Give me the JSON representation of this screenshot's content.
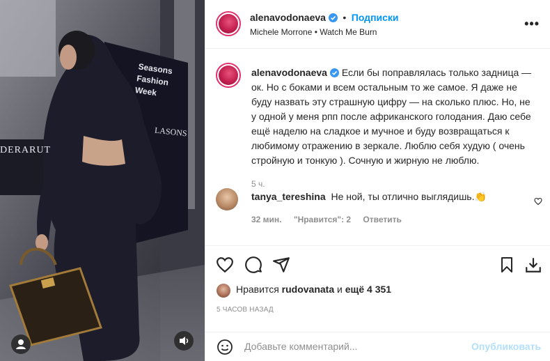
{
  "header": {
    "username": "alenavodonaeva",
    "dot": "•",
    "follow_label": "Подписки",
    "audio": "Michele Morrone • Watch Me Burn",
    "more": "•••"
  },
  "caption": {
    "username": "alenavodonaeva",
    "text": "Если бы поправлялась только задница — ок. Но с боками и всем остальным то же самое. Я даже не буду назвать эту страшную цифру — на сколько плюс. Но, не у одной у меня рпп после африканского голодания. Даю себе ещё наделю на сладкое и мучное и буду возвращаться к любимому отражению в зеркале. Люблю себя худую ( очень стройную и тонкую ). Сочную и жирную не люблю.",
    "time": "5 ч."
  },
  "comment": {
    "username": "tanya_tereshina",
    "text": "Не ной, ты отлично выглядишь.",
    "emoji": "👏",
    "time": "32 мин.",
    "likes_label": "\"Нравится\": 2",
    "reply_label": "Ответить"
  },
  "likes": {
    "prefix": "Нравится",
    "user": "rudovanata",
    "middle": "и",
    "rest": "ещё 4 351"
  },
  "post_date": "5 ЧАСОВ НАЗАД",
  "add_comment": {
    "placeholder": "Добавьте комментарий...",
    "publish_label": "Опубликовать"
  },
  "media": {
    "sign_lines": [
      "Seasons",
      "Fashion",
      "Week"
    ],
    "brand_text": "LASONS",
    "left_text": "DERARUT"
  },
  "colors": {
    "accent": "#0095f6",
    "publish_disabled": "#b2dffc",
    "story_ring": "#e1306c",
    "verified": "#3897f0"
  }
}
